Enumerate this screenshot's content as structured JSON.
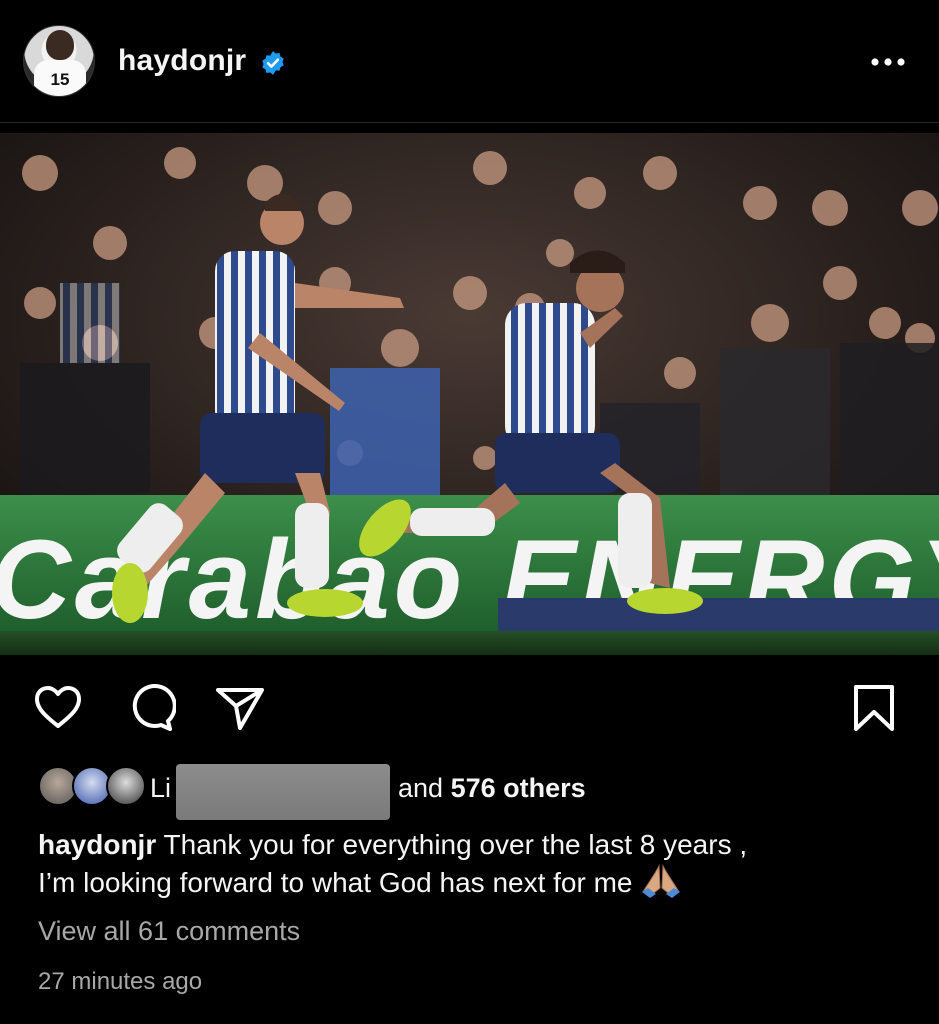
{
  "post": {
    "username": "haydonjr",
    "avatar_jersey_number": "15",
    "verified": true,
    "more_icon": "ellipsis-icon",
    "photo_banner_text": "Carabao ENERGY"
  },
  "actions": {
    "like_icon": "heart-icon",
    "comment_icon": "comment-icon",
    "share_icon": "send-icon",
    "save_icon": "bookmark-icon"
  },
  "likes": {
    "prefix": "Li",
    "suffix_and": "and",
    "count_text": "576 others"
  },
  "caption": {
    "username": "haydonjr",
    "line1": "Thank you for everything over the last 8 years ,",
    "line2": "I’m looking forward to what God has next for me"
  },
  "comments": {
    "view_all": "View all 61 comments"
  },
  "timestamp": "27 minutes ago",
  "colors": {
    "background": "#000000",
    "verified_blue": "#1d9bf0",
    "muted_text": "#a8a8a8",
    "banner_green": "#2f7d3d"
  }
}
